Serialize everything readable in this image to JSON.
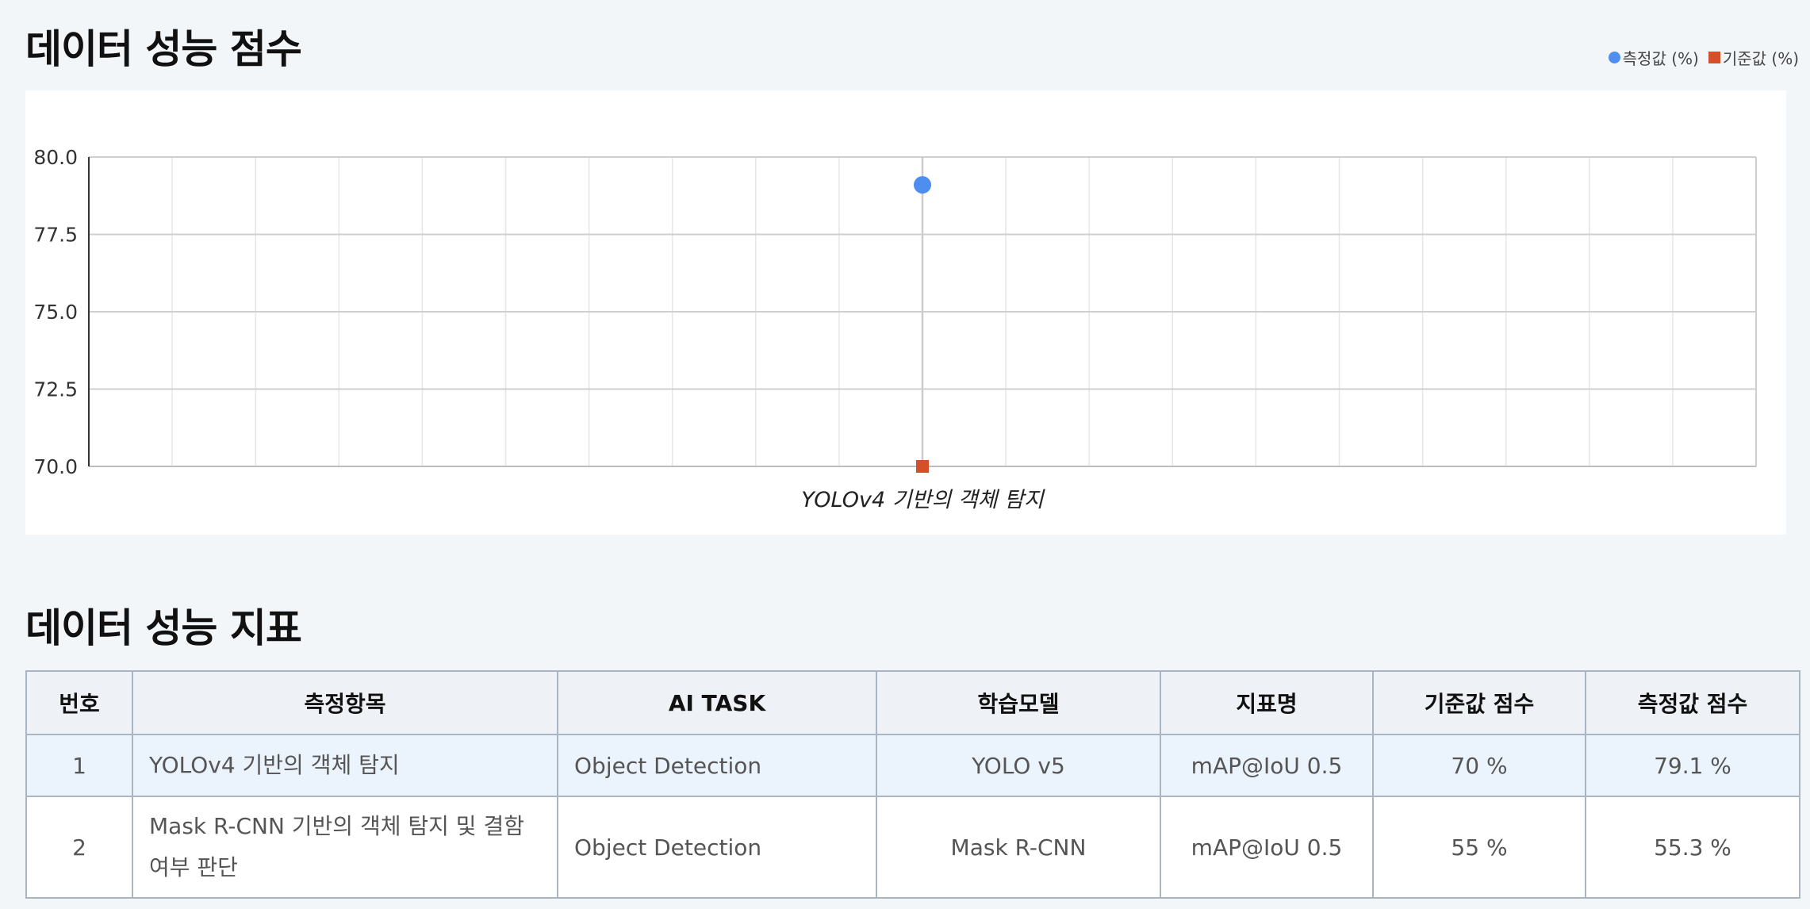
{
  "chart_section": {
    "title": "데이터 성능 점수"
  },
  "legend": [
    {
      "label": "측정값 (%)",
      "color": "#4d8ef0",
      "shape": "circle"
    },
    {
      "label": "기준값 (%)",
      "color": "#d4502a",
      "shape": "square"
    }
  ],
  "chart_data": {
    "type": "scatter",
    "categories": [
      "YOLOv4 기반의 객체 탐지"
    ],
    "series": [
      {
        "name": "측정값 (%)",
        "values": [
          79.1
        ],
        "color": "#4d8ef0",
        "marker": "circle"
      },
      {
        "name": "기준값 (%)",
        "values": [
          70
        ],
        "color": "#d4502a",
        "marker": "square"
      }
    ],
    "ylim": [
      70,
      80
    ],
    "yticks": [
      "70.0",
      "72.5",
      "75.0",
      "77.5",
      "80.0"
    ],
    "grid": true,
    "legend_position": "top-right"
  },
  "table_section": {
    "title": "데이터 성능 지표",
    "headers": [
      "번호",
      "측정항목",
      "AI TASK",
      "학습모델",
      "지표명",
      "기준값 점수",
      "측정값 점수"
    ],
    "rows": [
      {
        "no": "1",
        "item": "YOLOv4 기반의 객체 탐지",
        "task": "Object Detection",
        "model": "YOLO v5",
        "metric": "mAP@IoU 0.5",
        "baseline": "70 %",
        "measured": "79.1 %"
      },
      {
        "no": "2",
        "item": "Mask R-CNN 기반의 객체 탐지 및 결함 여부 판단",
        "task": "Object Detection",
        "model": "Mask R-CNN",
        "metric": "mAP@IoU 0.5",
        "baseline": "55 %",
        "measured": "55.3 %"
      }
    ]
  }
}
